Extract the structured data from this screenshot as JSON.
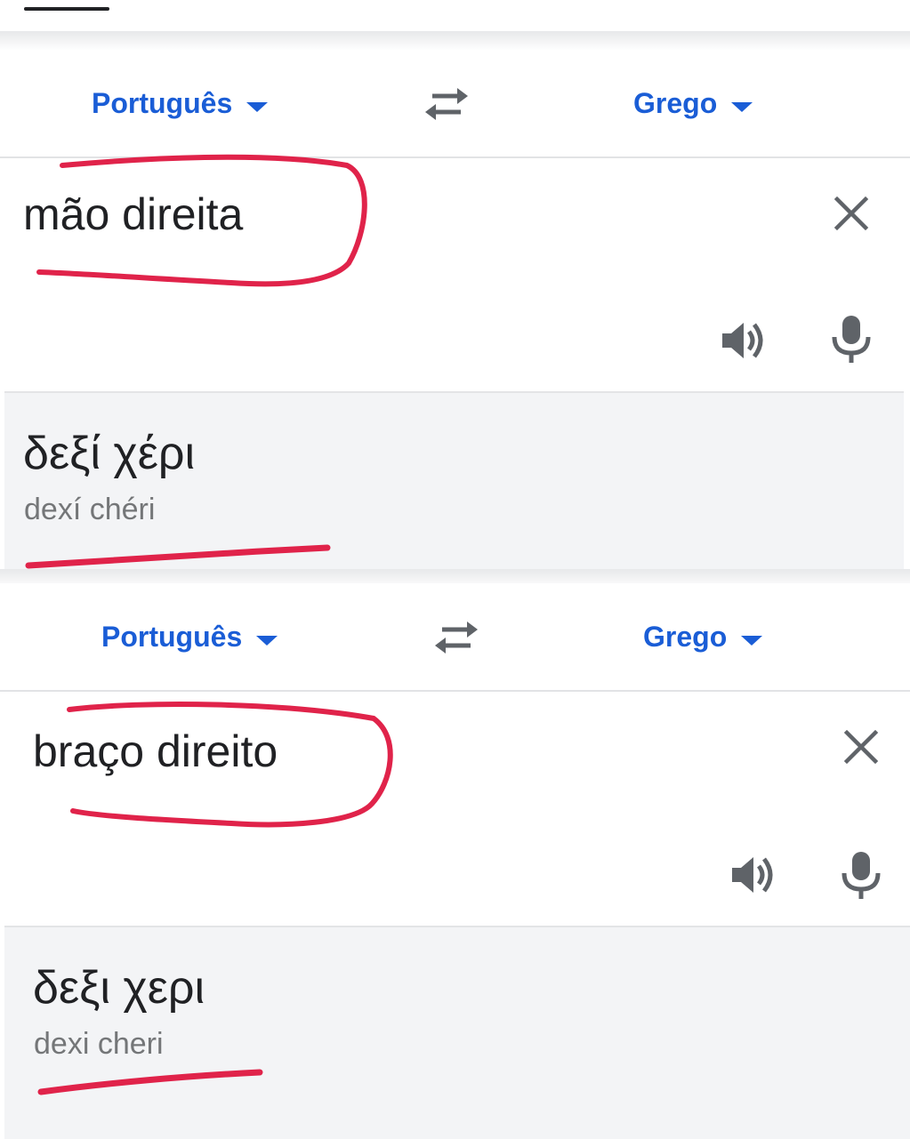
{
  "panels": [
    {
      "source_lang": "Português",
      "target_lang": "Grego",
      "source_text": "mão direita",
      "translation": "δεξί χέρι",
      "transliteration": "dexí chéri"
    },
    {
      "source_lang": "Português",
      "target_lang": "Grego",
      "source_text": "braço direito",
      "translation": "δεξι χερι",
      "transliteration": "dexi cheri"
    }
  ],
  "icons": {
    "swap": "swap-arrows-icon",
    "clear": "close-icon",
    "listen": "speaker-icon",
    "voice": "microphone-icon",
    "caret": "caret-down-icon"
  },
  "colors": {
    "accent": "#1a5dd6",
    "annotation": "#e0234a",
    "output_bg": "#f3f4f6"
  }
}
